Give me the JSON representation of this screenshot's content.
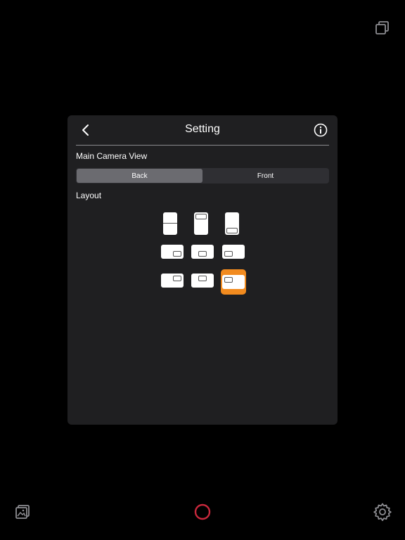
{
  "panel": {
    "title": "Setting",
    "back_icon": "chevron-left-icon",
    "info_icon": "info-circle-icon"
  },
  "main_camera": {
    "label": "Main Camera View",
    "options": [
      "Back",
      "Front"
    ],
    "selected": "Back"
  },
  "layout": {
    "label": "Layout",
    "options": [
      "portrait-split-horizontal",
      "portrait-pip-top",
      "portrait-pip-bottom",
      "landscape-pip-bottom-right",
      "landscape-pip-bottom-center",
      "landscape-pip-bottom-left",
      "landscape-pip-top-right",
      "landscape-pip-top-center",
      "landscape-pip-top-left"
    ],
    "selected_index": 8
  },
  "toolbar": {
    "switch_icon": "switch-camera-icon",
    "gallery_icon": "gallery-icon",
    "record_icon": "record-icon",
    "settings_icon": "gear-icon"
  },
  "colors": {
    "background": "#000000",
    "panel": "#1f1f21",
    "accent": "#f28b1f",
    "record": "#c8283c"
  }
}
